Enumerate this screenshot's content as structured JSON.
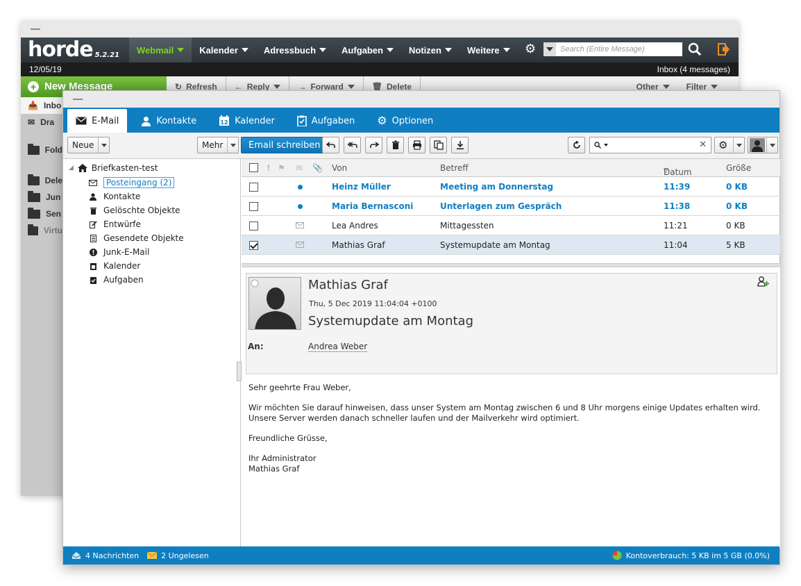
{
  "horde": {
    "logo": "horde",
    "version": "5.2.21",
    "menu": [
      "Webmail",
      "Kalender",
      "Adressbuch",
      "Aufgaben",
      "Notizen",
      "Weitere"
    ],
    "search_placeholder": "Search (Entire Message)",
    "date": "12/05/19",
    "inbox_status": "Inbox (4 messages)",
    "new_message": "New Message",
    "toolbar": [
      "Refresh",
      "Reply",
      "Forward",
      "Delete"
    ],
    "toolbar_right": [
      "Other",
      "Filter"
    ],
    "sidebar": [
      "Inbo",
      "Dra",
      "Fold",
      "Dele",
      "Jun",
      "Sen",
      "Virtu"
    ]
  },
  "tabs": [
    "E-Mail",
    "Kontakte",
    "Kalender",
    "Aufgaben",
    "Optionen"
  ],
  "toolbar": {
    "neue": "Neue",
    "mehr": "Mehr",
    "compose": "Email schreiben"
  },
  "folders": {
    "root": "Briefkasten-test",
    "items": [
      "Posteingang (2)",
      "Kontakte",
      "Gelöschte Objekte",
      "Entwürfe",
      "Gesendete Objekte",
      "Junk-E-Mail",
      "Kalender",
      "Aufgaben"
    ]
  },
  "list": {
    "columns": {
      "from": "Von",
      "subject": "Betreff",
      "date": "Datum",
      "size": "Größe"
    },
    "rows": [
      {
        "from": "Heinz Müller",
        "subject": "Meeting am Donnerstag",
        "date": "11:39",
        "size": "0 KB",
        "unread": true,
        "checked": false
      },
      {
        "from": "Maria Bernasconi",
        "subject": "Unterlagen zum Gespräch",
        "date": "11:38",
        "size": "0 KB",
        "unread": true,
        "checked": false
      },
      {
        "from": "Lea Andres",
        "subject": "Mittagessten",
        "date": "11:21",
        "size": "0 KB",
        "unread": false,
        "checked": false
      },
      {
        "from": "Mathias Graf",
        "subject": "Systemupdate am Montag",
        "date": "11:04",
        "size": "5 KB",
        "unread": false,
        "checked": true
      }
    ]
  },
  "preview": {
    "from": "Mathias Graf",
    "date": "Thu, 5 Dec 2019 11:04:04 +0100",
    "subject": "Systemupdate am Montag",
    "to_label": "An:",
    "to": "Andrea Weber",
    "body": [
      "Sehr geehrte Frau Weber,",
      "Wir möchten Sie darauf hinweisen, dass unser System am Montag zwischen 6 und 8 Uhr morgens einige Updates erhalten wird.",
      "Unsere Server werden danach schneller laufen und der Mailverkehr wird optimiert.",
      "Freundliche Grüsse,",
      "Ihr Administrator",
      "Mathias Graf"
    ]
  },
  "footer": {
    "messages": "4 Nachrichten",
    "unread": "2 Ungelesen",
    "quota": "Kontoverbrauch: 5 KB im 5 GB (0.0%)"
  },
  "colors": {
    "accent": "#0f7fc2",
    "horde_green": "#7ed321"
  }
}
